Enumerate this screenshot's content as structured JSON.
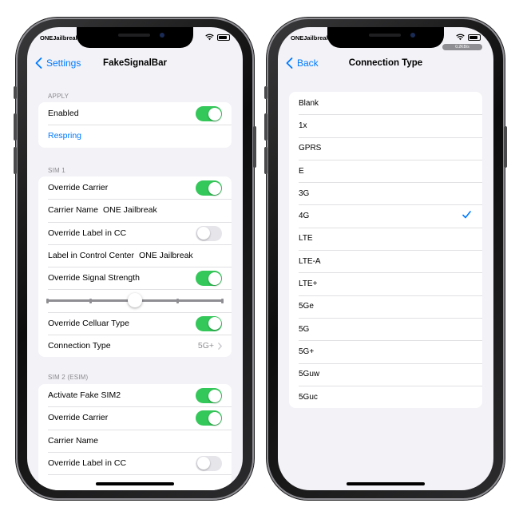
{
  "status": {
    "carrier": "ONEJailbreak",
    "speed": "0.2KB/s"
  },
  "left": {
    "nav": {
      "back_label": "Settings",
      "title": "FakeSignalBar"
    },
    "apply": {
      "header": "APPLY",
      "enabled_label": "Enabled",
      "enabled_on": true,
      "respring_label": "Respring"
    },
    "sim1": {
      "header": "SIM 1",
      "override_carrier_label": "Override Carrier",
      "override_carrier_on": true,
      "carrier_name_label": "Carrier Name",
      "carrier_name_value": "ONE Jailbreak",
      "override_label_cc_label": "Override Label in CC",
      "override_label_cc_on": false,
      "label_cc_label": "Label in Control Center",
      "label_cc_value": "ONE Jailbreak",
      "override_signal_label": "Override Signal Strength",
      "override_signal_on": true,
      "signal_strength": 0.5,
      "override_cellular_label": "Override Celluar Type",
      "override_cellular_on": true,
      "connection_type_label": "Connection Type",
      "connection_type_value": "5G+"
    },
    "sim2": {
      "header": "SIM 2 (ESIM)",
      "activate_label": "Activate Fake SIM2",
      "activate_on": true,
      "override_carrier_label": "Override Carrier",
      "override_carrier_on": true,
      "carrier_name_label": "Carrier Name",
      "override_label_cc_label": "Override Label in CC",
      "override_label_cc_on": false
    }
  },
  "right": {
    "nav": {
      "back_label": "Back",
      "title": "Connection Type"
    },
    "options": [
      "Blank",
      "1x",
      "GPRS",
      "E",
      "3G",
      "4G",
      "LTE",
      "LTE-A",
      "LTE+",
      "5Ge",
      "5G",
      "5G+",
      "5Guw",
      "5Guc"
    ],
    "selected_index": 5
  },
  "colors": {
    "accent": "#007aff",
    "toggle_on": "#34c759",
    "toggle_off": "#e5e5ea",
    "background": "#f2f2f7"
  }
}
